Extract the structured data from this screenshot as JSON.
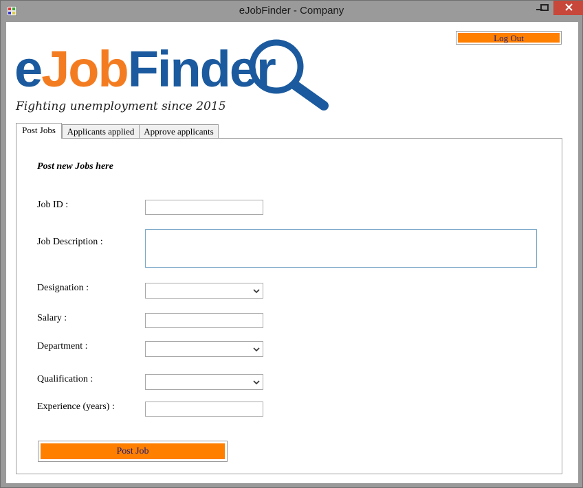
{
  "window": {
    "title": "eJobFinder - Company"
  },
  "header": {
    "logout_label": "Log Out"
  },
  "logo": {
    "text_e": "e",
    "text_job": "Job",
    "text_finder": "Finder",
    "tagline": "Fighting unemployment since 2015",
    "colors": {
      "blue": "#1b5a9e",
      "orange": "#f47c20"
    }
  },
  "tabs": [
    {
      "label": "Post Jobs",
      "active": true
    },
    {
      "label": "Applicants applied",
      "active": false
    },
    {
      "label": "Approve applicants",
      "active": false
    }
  ],
  "form": {
    "heading": "Post new Jobs here",
    "job_id_label": "Job ID :",
    "job_id_value": "",
    "job_description_label": "Job Description :",
    "job_description_value": "",
    "designation_label": "Designation :",
    "designation_value": "",
    "salary_label": "Salary :",
    "salary_value": "",
    "department_label": "Department :",
    "department_value": "",
    "qualification_label": "Qualification :",
    "qualification_value": "",
    "experience_label": "Experience (years) :",
    "experience_value": "",
    "submit_label": "Post Job"
  },
  "colors": {
    "button": "#ff7f00",
    "button_text": "#1a1a7a",
    "close": "#c7473a"
  }
}
